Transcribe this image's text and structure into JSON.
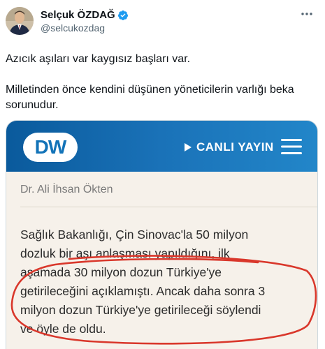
{
  "user": {
    "display_name": "Selçuk ÖZDAĞ",
    "handle": "@selcukozdag",
    "verified_icon": "verified-badge-icon",
    "verified_color": "#1d9bf0"
  },
  "tweet": {
    "paragraphs": [
      "Azıcık aşıları var kaygısız başları var.",
      "Milletinden önce kendini düşünen yöneticilerin varlığı beka sorunudur."
    ]
  },
  "media": {
    "logo_text": "DW",
    "live_label": "CANLI YAYIN",
    "author": "Dr. Ali İhsan Ökten",
    "article_lines": [
      "Sağlık Bakanlığı, Çin Sinovac'la 50 milyon",
      "dozluk bir aşı anlaşması yapıldığını, ilk",
      "aşamada 30 milyon dozun Türkiye'ye",
      "getirileceğini açıklamıştı. Ancak daha sonra 3",
      "milyon dozun Türkiye'ye getirileceği söylendi",
      "ve öyle de oldu."
    ],
    "brand_color": "#1273b8",
    "annotation_color": "#d9372b"
  }
}
